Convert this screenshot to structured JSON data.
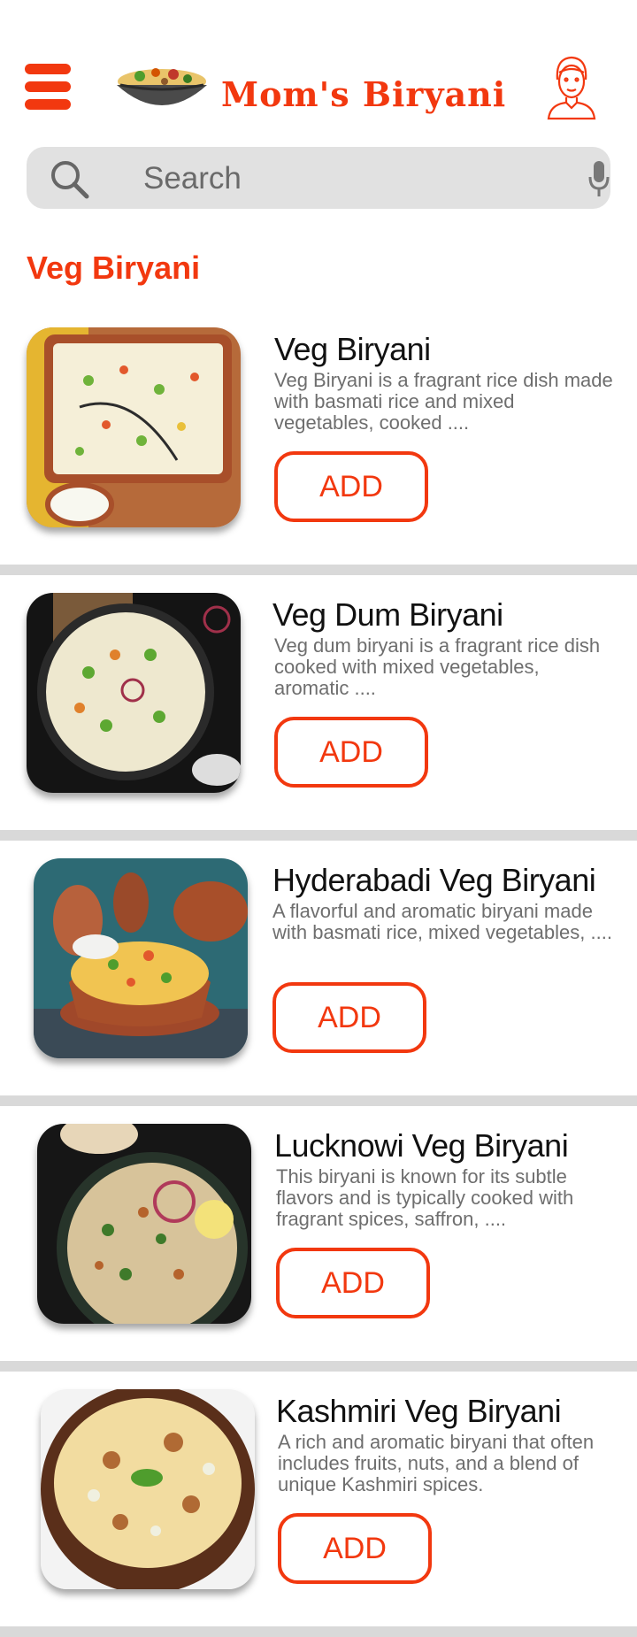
{
  "app": {
    "brand": "Mom's Biryani"
  },
  "search": {
    "placeholder": "Search"
  },
  "section": {
    "title": "Veg Biryani"
  },
  "items": [
    {
      "title": "Veg Biryani",
      "description": "Veg Biryani is a fragrant rice dish made with basmati rice and mixed vegetables, cooked ....",
      "add_label": "ADD"
    },
    {
      "title": "Veg Dum Biryani",
      "description": "Veg dum biryani is a fragrant rice dish cooked with mixed vegetables, aromatic ....",
      "add_label": "ADD"
    },
    {
      "title": "Hyderabadi Veg Biryani",
      "description": "A flavorful and aromatic biryani made with basmati rice, mixed vegetables, ....",
      "add_label": "ADD"
    },
    {
      "title": "Lucknowi Veg Biryani",
      "description": "This biryani is known for its subtle flavors and is typically cooked with fragrant spices, saffron, ....",
      "add_label": "ADD"
    },
    {
      "title": "Kashmiri Veg Biryani",
      "description": "A rich and aromatic biryani that often includes fruits, nuts, and a blend of unique Kashmiri spices.",
      "add_label": "ADD"
    }
  ],
  "colors": {
    "accent": "#f2380f",
    "divider": "#d9d9d9",
    "search_bg": "#e1e1e1"
  }
}
